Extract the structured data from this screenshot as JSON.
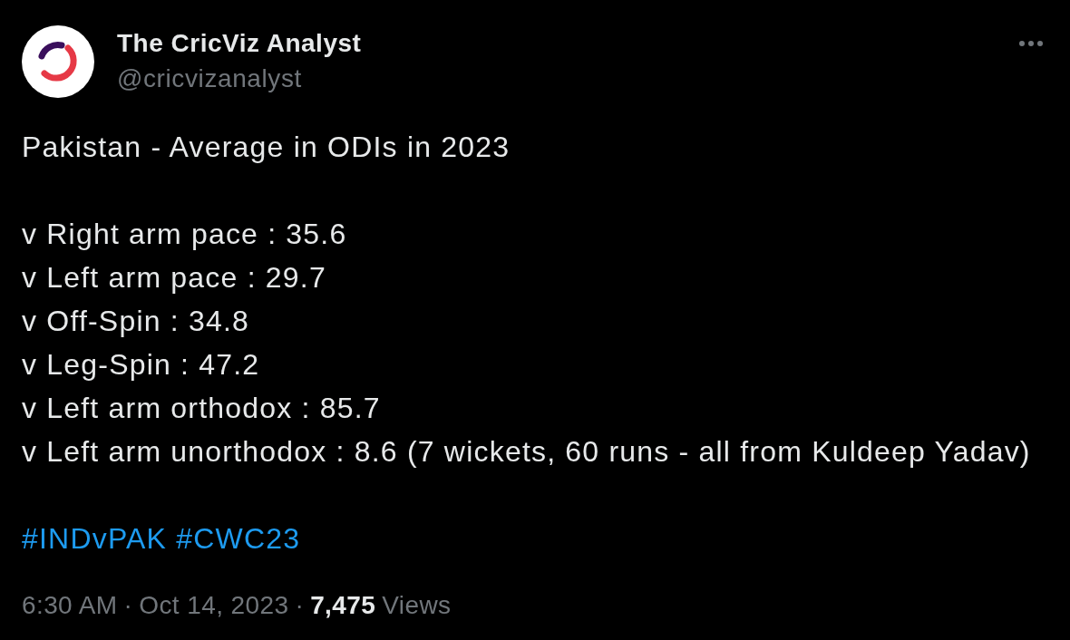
{
  "author": {
    "name": "The CricViz Analyst",
    "handle": "@cricvizanalyst"
  },
  "post": {
    "title": "Pakistan - Average in ODIs in 2023",
    "lines": [
      "v Right arm pace : 35.6",
      "v Left arm pace : 29.7",
      "v Off-Spin : 34.8",
      "v Leg-Spin : 47.2",
      "v Left arm orthodox : 85.7",
      "v Left arm unorthodox : 8.6 (7 wickets, 60 runs - all from Kuldeep Yadav)"
    ],
    "hashtags": [
      "#INDvPAK",
      "#CWC23"
    ]
  },
  "meta": [
    {
      "kind": "time",
      "text": "6:30 AM"
    },
    {
      "kind": "separator",
      "text": "·"
    },
    {
      "kind": "date",
      "text": "Oct 14, 2023"
    },
    {
      "kind": "separator",
      "text": "·"
    },
    {
      "kind": "count",
      "text": "7,475"
    },
    {
      "kind": "label",
      "text": "Views"
    }
  ]
}
